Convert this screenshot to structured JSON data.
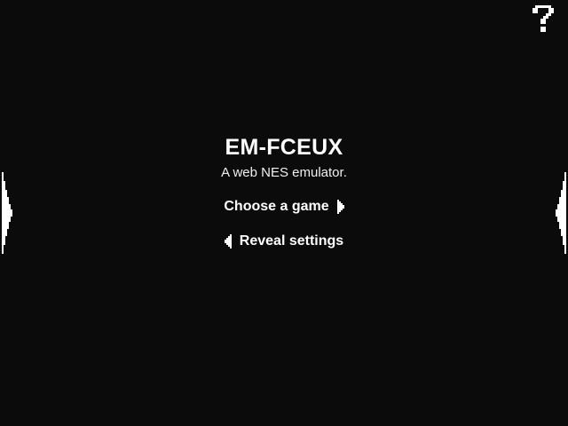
{
  "app": {
    "title": "EM-FCEUX",
    "subtitle": "A web NES emulator."
  },
  "menu": {
    "choose_game_label": "Choose a game",
    "reveal_settings_label": "Reveal settings"
  },
  "icons": {
    "help": "question-mark-icon",
    "choose_arrow": "arrow-right-icon",
    "reveal_arrow": "arrow-left-icon",
    "left_edge": "left-edge-arrow-icon",
    "right_edge": "right-edge-arrow-icon"
  },
  "colors": {
    "background": "#0b0b0b",
    "foreground": "#ffffff"
  }
}
